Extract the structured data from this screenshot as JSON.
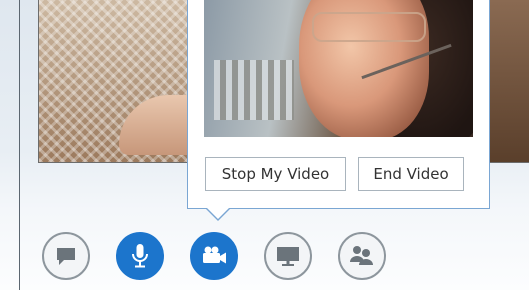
{
  "popup": {
    "stop_video_label": "Stop My Video",
    "end_video_label": "End Video"
  },
  "toolbar": {
    "buttons": [
      {
        "icon": "im-icon",
        "active": false
      },
      {
        "icon": "microphone-icon",
        "active": true
      },
      {
        "icon": "video-camera-icon",
        "active": true
      },
      {
        "icon": "present-icon",
        "active": false
      },
      {
        "icon": "participants-icon",
        "active": false
      }
    ]
  },
  "colors": {
    "accent": "#1c75cc",
    "popup_border": "#7aa6d3",
    "toolbar_ring": "#8d969d",
    "icon_gray": "#6b747b"
  }
}
